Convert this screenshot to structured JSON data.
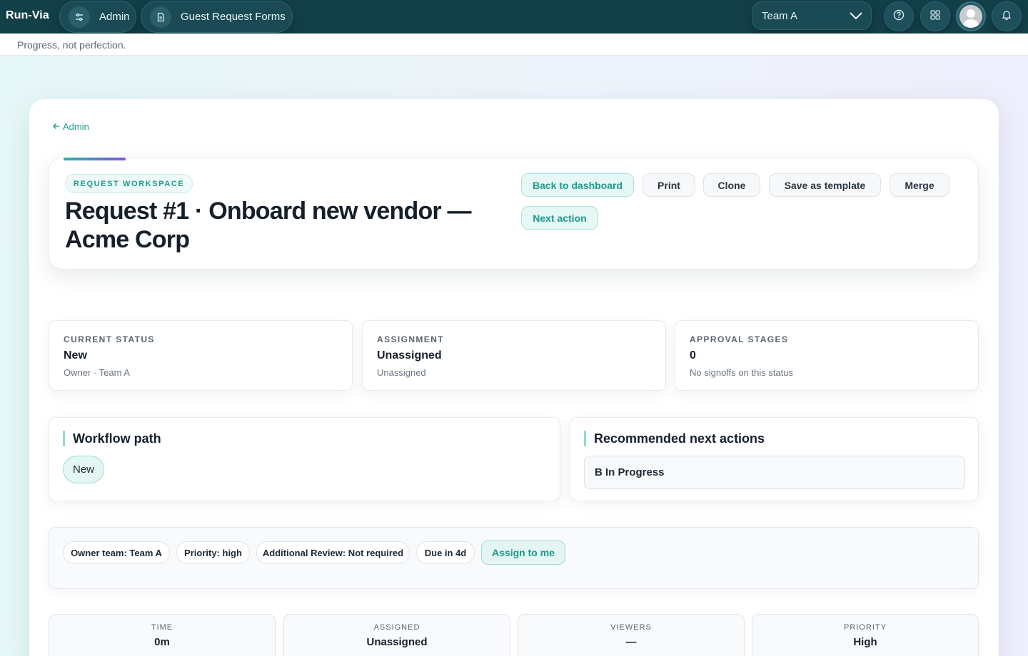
{
  "app": {
    "brand": "Run-Via"
  },
  "nav": {
    "admin_label": "Admin",
    "forms_label": "Guest Request Forms",
    "team_selected": "Team A",
    "icons": [
      "help-icon",
      "apps-grid-icon",
      "avatar",
      "bell-icon"
    ]
  },
  "tagline": "Progress, not perfection.",
  "breadcrumb": {
    "back_label": "Admin"
  },
  "hero": {
    "badge": "REQUEST WORKSPACE",
    "title": "Request #1 · Onboard new vendor — Acme Corp",
    "actions": {
      "back_dashboard": "Back to dashboard",
      "print": "Print",
      "clone": "Clone",
      "save_template": "Save as template",
      "merge": "Merge",
      "next_action": "Next action"
    }
  },
  "stats": [
    {
      "label": "CURRENT STATUS",
      "value": "New",
      "sub": "Owner · Team A"
    },
    {
      "label": "ASSIGNMENT",
      "value": "Unassigned",
      "sub": "Unassigned"
    },
    {
      "label": "APPROVAL STAGES",
      "value": "0",
      "sub": "No signoffs on this status"
    }
  ],
  "workflow": {
    "title": "Workflow path",
    "steps": [
      "New"
    ]
  },
  "recommended": {
    "title": "Recommended next actions",
    "items": [
      "B In Progress"
    ]
  },
  "meta": {
    "chips": [
      "Owner team: Team A",
      "Priority: high",
      "Additional Review: Not required",
      "Due in 4d"
    ],
    "assign_label": "Assign to me"
  },
  "metrics": [
    {
      "label": "TIME",
      "value": "0m"
    },
    {
      "label": "ASSIGNED",
      "value": "Unassigned"
    },
    {
      "label": "VIEWERS",
      "value": "—"
    },
    {
      "label": "PRIORITY",
      "value": "High"
    }
  ],
  "colors": {
    "topbar": "#133f49",
    "accent": "#1e9a8c",
    "accent_soft": "#e6f8f5"
  }
}
